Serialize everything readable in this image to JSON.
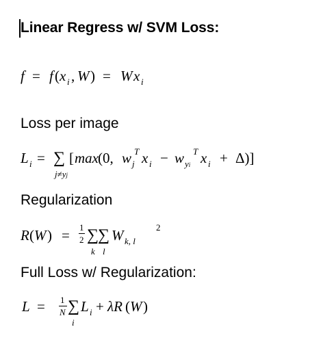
{
  "title": "Linear Regress w/ SVM Loss:",
  "headings": {
    "loss_per_image": "Loss per image",
    "regularization": "Regularization",
    "full_loss": "Full Loss w/ Regularization:"
  },
  "equations": {
    "f": "f = f(x_i, W) = Wx_i",
    "loss": "L_i = Σ_{j≠y_j} [max(0, w_j^T x_i − w_{y_i}^T x_i + Δ)]",
    "reg": "R(W) = ½ Σ_k Σ_l W_{k,l}^2",
    "full": "L = (1/N) Σ_i L_i + λR(W)"
  }
}
